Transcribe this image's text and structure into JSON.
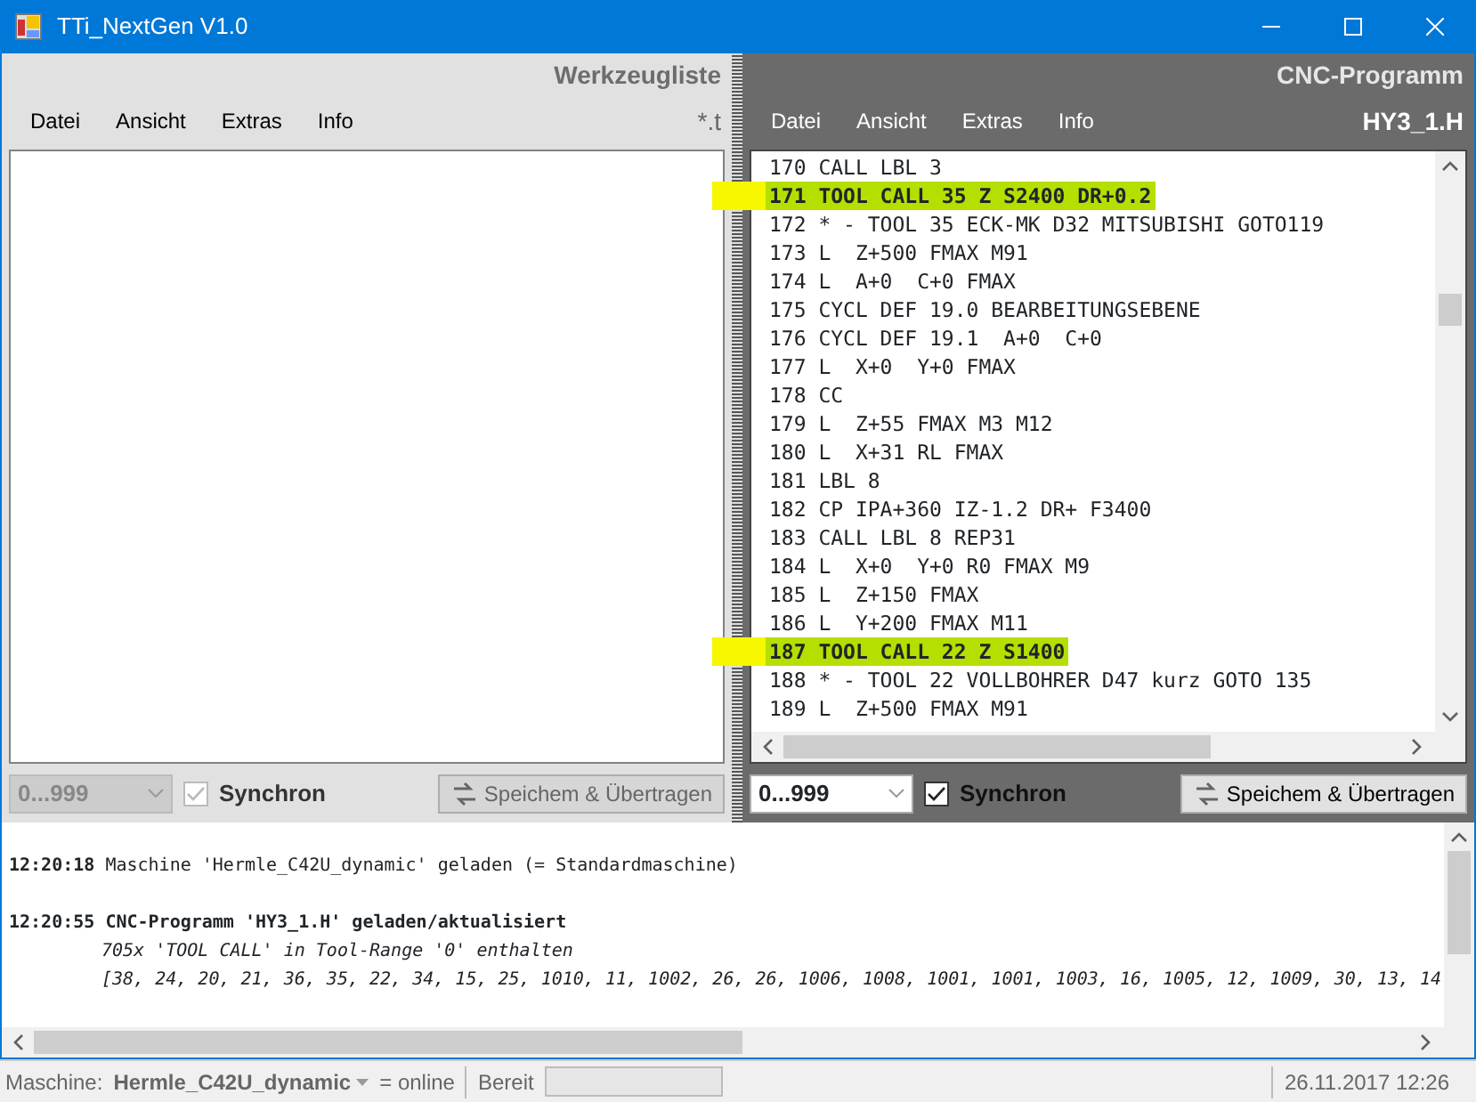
{
  "window": {
    "title": "TTi_NextGen V1.0"
  },
  "tool_panel": {
    "title": "Werkzeugliste",
    "menu": [
      "Datei",
      "Ansicht",
      "Extras",
      "Info"
    ],
    "file_label": "*.t",
    "range": {
      "value": "0...999",
      "disabled": true
    },
    "sync": {
      "label": "Synchron",
      "checked": true,
      "disabled": true
    },
    "save_button": {
      "label": "Speichem & Übertragen",
      "disabled": true
    }
  },
  "cnc_panel": {
    "title": "CNC-Programm",
    "menu": [
      "Datei",
      "Ansicht",
      "Extras",
      "Info"
    ],
    "file_label": "HY3_1.H",
    "lines": [
      {
        "text": "170 CALL LBL 3",
        "highlighted": false
      },
      {
        "text": "171 TOOL CALL 35 Z S2400 DR+0.2",
        "highlighted": true
      },
      {
        "text": "172 * - TOOL 35 ECK-MK D32 MITSUBISHI GOTO119",
        "highlighted": false
      },
      {
        "text": "173 L  Z+500 FMAX M91",
        "highlighted": false
      },
      {
        "text": "174 L  A+0  C+0 FMAX",
        "highlighted": false
      },
      {
        "text": "175 CYCL DEF 19.0 BEARBEITUNGSEBENE",
        "highlighted": false
      },
      {
        "text": "176 CYCL DEF 19.1  A+0  C+0",
        "highlighted": false
      },
      {
        "text": "177 L  X+0  Y+0 FMAX",
        "highlighted": false
      },
      {
        "text": "178 CC",
        "highlighted": false
      },
      {
        "text": "179 L  Z+55 FMAX M3 M12",
        "highlighted": false
      },
      {
        "text": "180 L  X+31 RL FMAX",
        "highlighted": false
      },
      {
        "text": "181 LBL 8",
        "highlighted": false
      },
      {
        "text": "182 CP IPA+360 IZ-1.2 DR+ F3400",
        "highlighted": false
      },
      {
        "text": "183 CALL LBL 8 REP31",
        "highlighted": false
      },
      {
        "text": "184 L  X+0  Y+0 R0 FMAX M9",
        "highlighted": false
      },
      {
        "text": "185 L  Z+150 FMAX",
        "highlighted": false
      },
      {
        "text": "186 L  Y+200 FMAX M11",
        "highlighted": false
      },
      {
        "text": "187 TOOL CALL 22 Z S1400",
        "highlighted": true
      },
      {
        "text": "188 * - TOOL 22 VOLLBOHRER D47 kurz GOTO 135",
        "highlighted": false
      },
      {
        "text": "189 L  Z+500 FMAX M91",
        "highlighted": false
      }
    ],
    "range": {
      "value": "0...999",
      "disabled": false
    },
    "sync": {
      "label": "Synchron",
      "checked": true,
      "disabled": false
    },
    "save_button": {
      "label": "Speichem & Übertragen",
      "disabled": false
    }
  },
  "log": [
    {
      "kind": "plain",
      "time": "12:20:18",
      "text": "Maschine 'Hermle_C42U_dynamic' geladen (= Standardmaschine)"
    },
    {
      "kind": "header",
      "time": "12:20:55",
      "text": "CNC-Programm 'HY3_1.H' geladen/aktualisiert"
    },
    {
      "kind": "detail",
      "text": "705x 'TOOL CALL' in Tool-Range '0' enthalten"
    },
    {
      "kind": "detail",
      "text": "[38, 24, 20, 21, 36, 35, 22, 34, 15, 25, 1010, 11, 1002, 26, 26, 1006, 1008, 1001, 1001, 1003, 16, 1005, 12, 1009, 30, 13, 14"
    }
  ],
  "status_bar": {
    "machine_label": "Maschine:",
    "machine": "Hermle_C42U_dynamic",
    "machine_state": "= online",
    "state": "Bereit",
    "progress": {
      "level": 0
    },
    "datetime": "26.11.2017 12:26"
  }
}
